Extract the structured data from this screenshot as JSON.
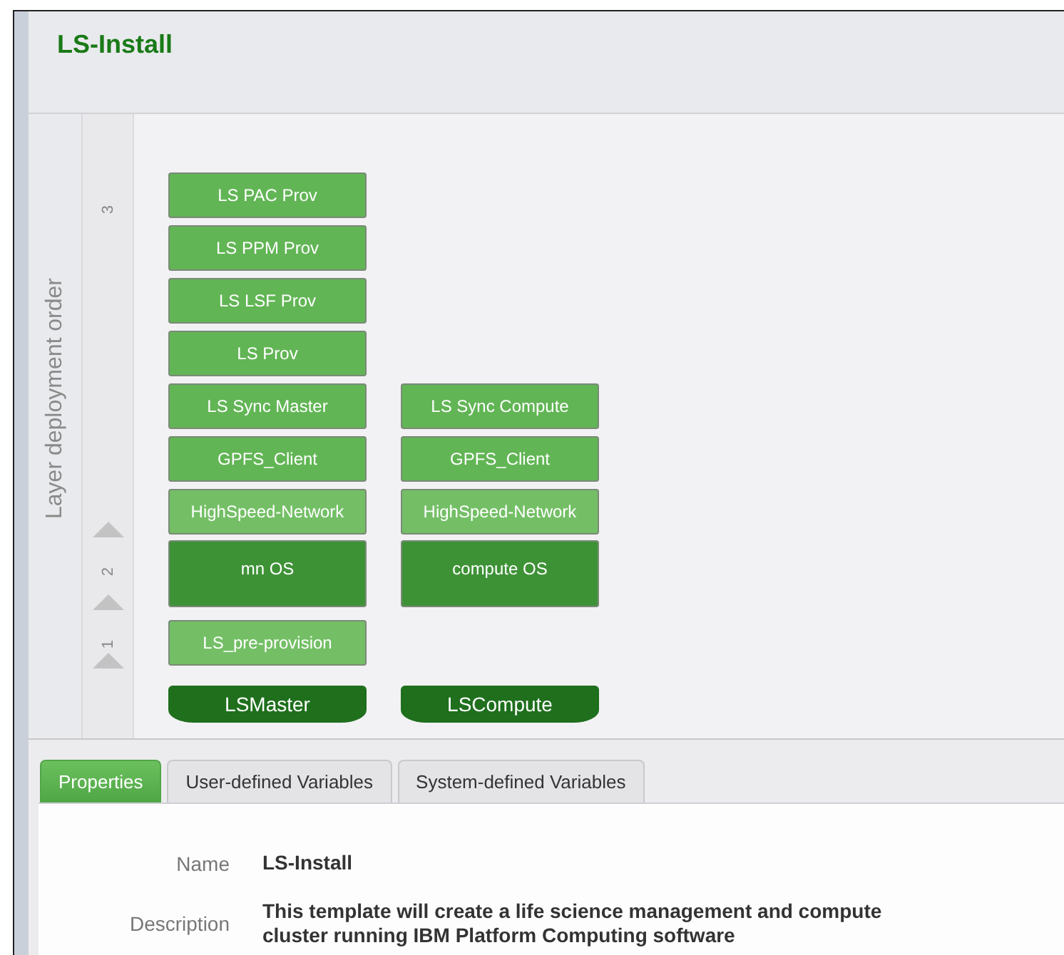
{
  "title": "LS-Install",
  "axis_label": "Layer deployment order",
  "layers": [
    {
      "number": "3",
      "columns": [
        {
          "nodes": [
            {
              "label": "LS PAC Prov",
              "kind": "package"
            },
            {
              "label": "LS PPM Prov",
              "kind": "package"
            },
            {
              "label": "LS LSF Prov",
              "kind": "package"
            },
            {
              "label": "LS Prov",
              "kind": "package"
            },
            {
              "label": "LS Sync Master",
              "kind": "package"
            },
            {
              "label": "GPFS_Client",
              "kind": "package"
            },
            {
              "label": "HighSpeed-Network",
              "kind": "network"
            }
          ]
        },
        {
          "nodes": [
            {
              "label": "LS Sync Compute",
              "kind": "package"
            },
            {
              "label": "GPFS_Client",
              "kind": "package"
            },
            {
              "label": "HighSpeed-Network",
              "kind": "network"
            }
          ]
        }
      ]
    },
    {
      "number": "2",
      "columns": [
        {
          "nodes": [
            {
              "label": "mn OS",
              "kind": "os"
            }
          ]
        },
        {
          "nodes": [
            {
              "label": "compute OS",
              "kind": "os"
            }
          ]
        }
      ]
    },
    {
      "number": "1",
      "columns": [
        {
          "nodes": [
            {
              "label": "LS_pre-provision",
              "kind": "network"
            }
          ]
        },
        {}
      ]
    }
  ],
  "hosts": [
    "LSMaster",
    "LSCompute"
  ],
  "tabs": [
    {
      "label": "Properties",
      "selected": true
    },
    {
      "label": "User-defined Variables",
      "selected": false
    },
    {
      "label": "System-defined Variables",
      "selected": false
    }
  ],
  "properties": [
    {
      "label": "Name",
      "value": "LS-Install"
    },
    {
      "label": "Description",
      "value": "This template will create a life science management and compute cluster running IBM Platform Computing software"
    }
  ]
}
